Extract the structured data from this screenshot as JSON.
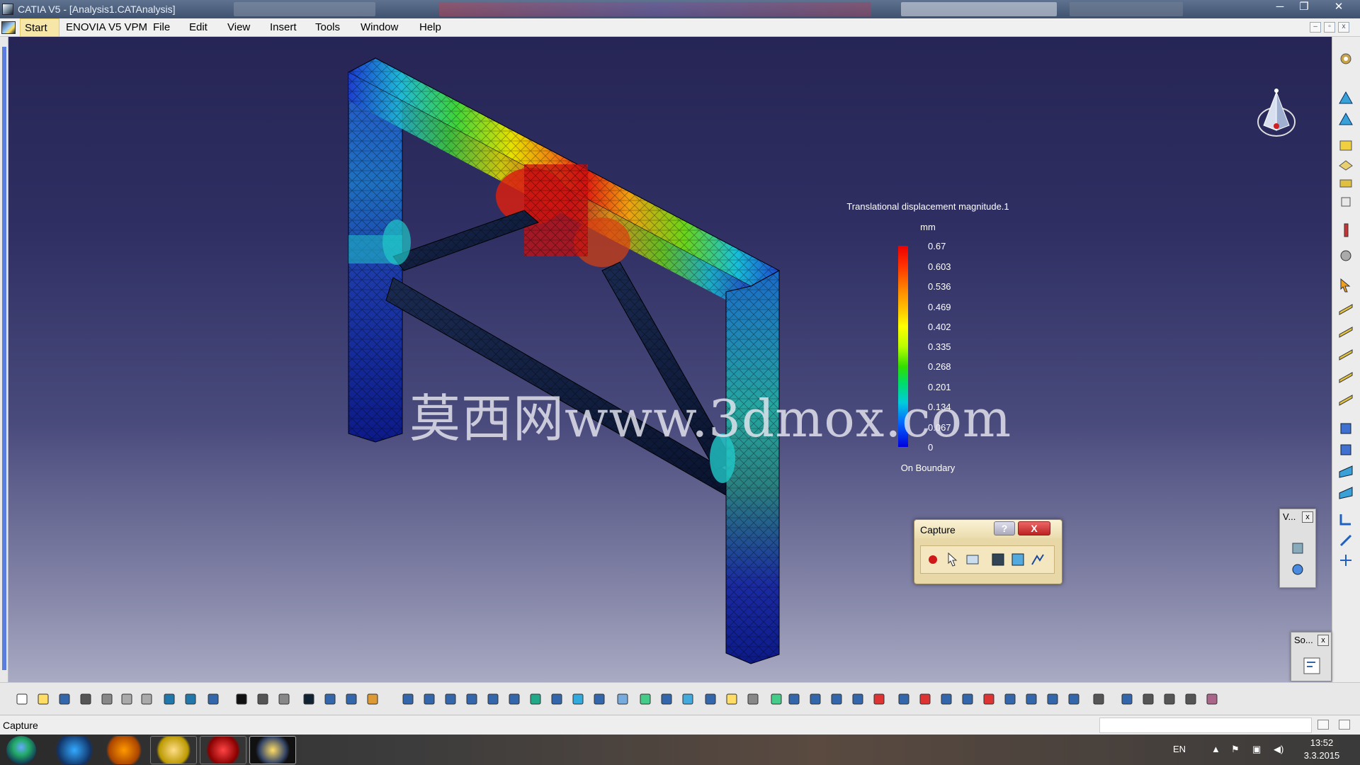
{
  "window": {
    "title": "CATIA V5 - [Analysis1.CATAnalysis]",
    "minimize": "─",
    "maximize": "❐",
    "close": "✕"
  },
  "menu": {
    "items": [
      "Start",
      "ENOVIA V5 VPM",
      "File",
      "Edit",
      "View",
      "Insert",
      "Tools",
      "Window",
      "Help"
    ],
    "mdi_min": "–",
    "mdi_restore": "▫",
    "mdi_close": "x"
  },
  "legend": {
    "title": "Translational displacement magnitude.1",
    "unit": "mm",
    "values": [
      "0.67",
      "0.603",
      "0.536",
      "0.469",
      "0.402",
      "0.335",
      "0.268",
      "0.201",
      "0.134",
      "0.067",
      "0"
    ],
    "footer": "On Boundary"
  },
  "watermark": {
    "text": "莫西网www.3dmox.com"
  },
  "capture_dialog": {
    "title": "Capture",
    "help": "?",
    "close": "X"
  },
  "mini_panels": {
    "view_title": "V...",
    "solver_title": "So...",
    "close": "x"
  },
  "status": {
    "text": "Capture"
  },
  "taskbar": {
    "lang": "EN",
    "time": "13:52",
    "date": "3.3.2015"
  },
  "colors": {
    "viewport_top": "#262555",
    "viewport_bottom": "#a9aac3",
    "legend_red": "#ee0000",
    "legend_blue": "#0000dd"
  }
}
